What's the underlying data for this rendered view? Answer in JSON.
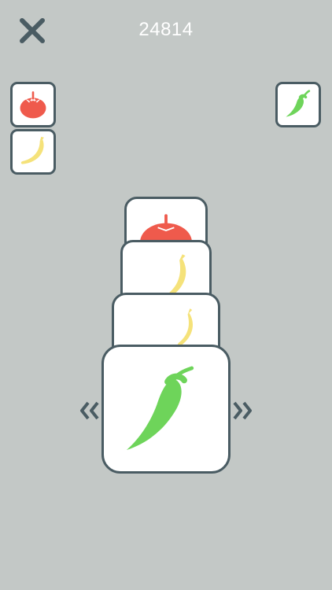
{
  "score": "24814",
  "colors": {
    "background": "#c3c8c6",
    "card_border": "#4a5c63",
    "tomato": "#ef5a4c",
    "banana": "#f5e27a",
    "pepper": "#6ed45a"
  },
  "icons": {
    "close": "close-icon",
    "left_arrows": "double-chevron-left-icon",
    "right_arrows": "double-chevron-right-icon"
  },
  "left_collection": [
    "tomato",
    "banana"
  ],
  "right_collection": [
    "pepper"
  ],
  "stack": [
    "tomato",
    "banana",
    "banana",
    "pepper"
  ]
}
